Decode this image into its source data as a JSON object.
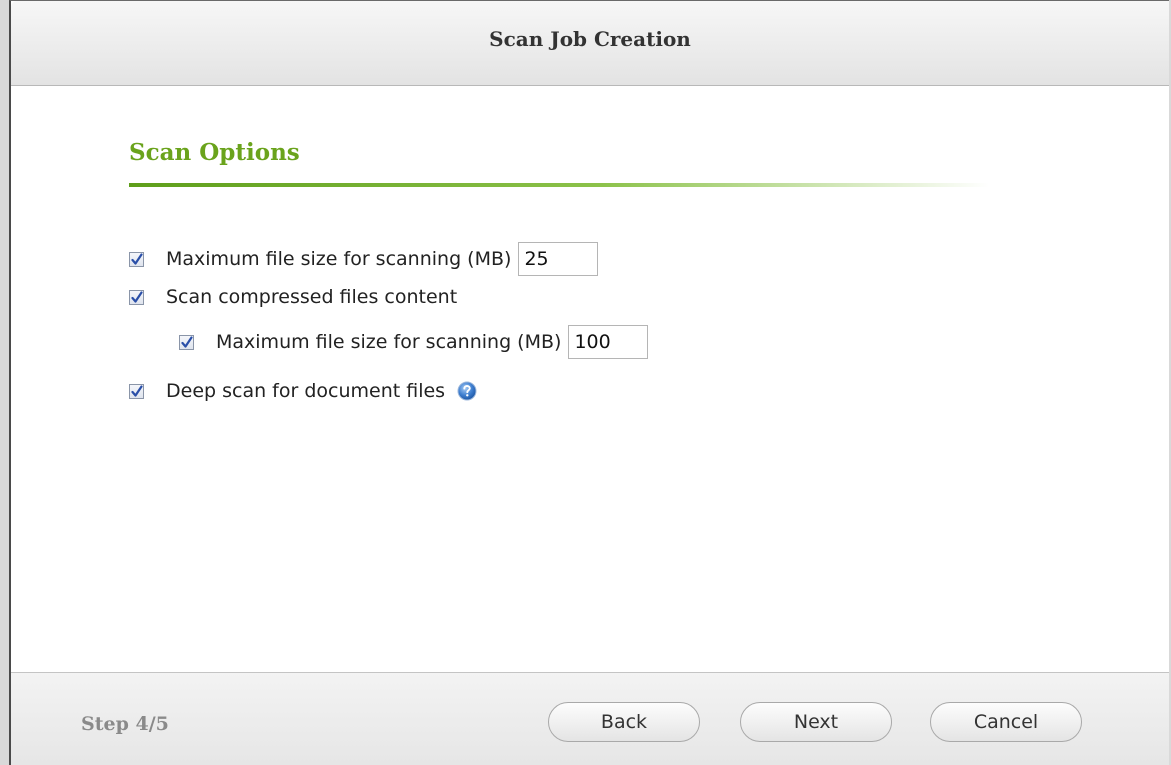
{
  "dialog": {
    "title": "Scan Job Creation"
  },
  "section": {
    "title": "Scan Options"
  },
  "options": {
    "max_file_size": {
      "label": "Maximum file size for scanning (MB)",
      "value": "25",
      "checked": true
    },
    "scan_compressed": {
      "label": "Scan compressed files content",
      "checked": true
    },
    "compressed_max_file_size": {
      "label": "Maximum file size for scanning (MB)",
      "value": "100",
      "checked": true
    },
    "deep_scan": {
      "label": "Deep scan for document files",
      "checked": true,
      "help_icon": "help-icon"
    }
  },
  "footer": {
    "step": "Step 4/5",
    "back_label": "Back",
    "next_label": "Next",
    "cancel_label": "Cancel"
  },
  "colors": {
    "accent_green": "#6aa31c",
    "checkmark_blue": "#2a4fa8"
  }
}
